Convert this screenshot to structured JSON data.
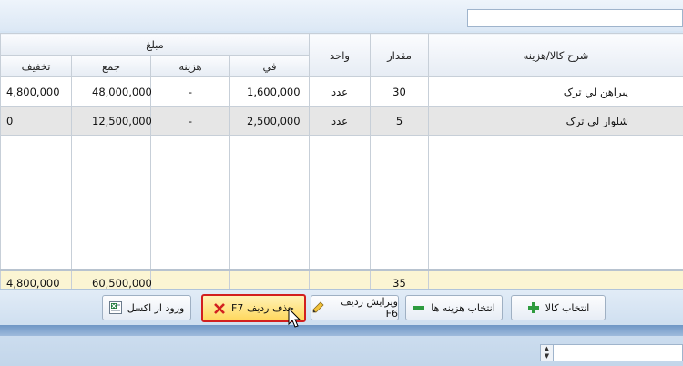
{
  "table": {
    "headers": {
      "amount_group": "مبلغ",
      "discount": "تخفيف",
      "total": "جمع",
      "cost": "هزينه",
      "unit_price": "في",
      "unit": "واحد",
      "quantity": "مقدار",
      "description": "شرح کالا/هزينه"
    },
    "rows": [
      {
        "discount": "4,800,000",
        "total": "48,000,000",
        "cost": "-",
        "unit_price": "1,600,000",
        "unit": "عدد",
        "quantity": "30",
        "description": "پيراهن لي ترک"
      },
      {
        "discount": "0",
        "total": "12,500,000",
        "cost": "-",
        "unit_price": "2,500,000",
        "unit": "عدد",
        "quantity": "5",
        "description": "شلوار لي ترک"
      }
    ],
    "totals": {
      "discount": "4,800,000",
      "total": "60,500,000",
      "quantity": "35"
    }
  },
  "toolbar": {
    "import_excel": "ورود از اکسل",
    "delete_row": "حذف رديف F7",
    "edit_row": "ويرايش رديف F6",
    "select_costs": "انتخاب هزينه ها",
    "select_item": "انتخاب کالا"
  },
  "colors": {
    "highlight_border": "#d21f1f",
    "highlight_fill": "#ffd75c",
    "totals_row": "#fbf5d3"
  }
}
